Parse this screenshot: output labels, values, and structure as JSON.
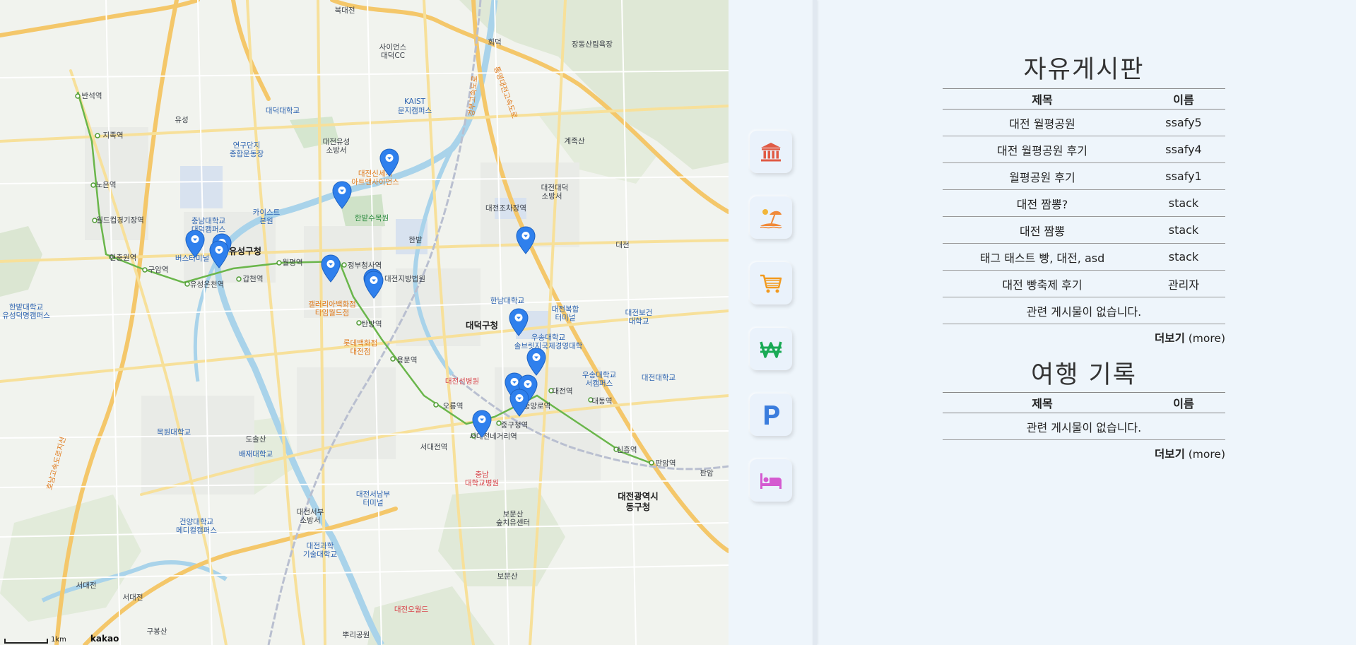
{
  "map": {
    "labels": [
      {
        "text": "북대전",
        "style": "",
        "id": "l1"
      },
      {
        "text": "사이언스",
        "style": "",
        "id": "l2"
      },
      {
        "text": "대덕CC",
        "style": "",
        "id": "l3"
      },
      {
        "text": "회덕",
        "style": "",
        "id": "l4"
      },
      {
        "text": "장동산림욕장",
        "style": "",
        "id": "l5"
      },
      {
        "text": "반석역",
        "style": "",
        "id": "l6"
      },
      {
        "text": "대덕대학교",
        "style": "blue",
        "id": "l7"
      },
      {
        "text": "KAIST",
        "style": "blue",
        "id": "l8"
      },
      {
        "text": "문지캠퍼스",
        "style": "blue",
        "id": "l9"
      },
      {
        "text": "유성",
        "style": "",
        "id": "l10"
      },
      {
        "text": "지족역",
        "style": "",
        "id": "l11"
      },
      {
        "text": "연구단지",
        "style": "blue",
        "id": "l12"
      },
      {
        "text": "종합운동장",
        "style": "blue",
        "id": "l13"
      },
      {
        "text": "대전유성",
        "style": "",
        "id": "l14"
      },
      {
        "text": "소방서",
        "style": "",
        "id": "l15"
      },
      {
        "text": "계족산",
        "style": "",
        "id": "l16"
      },
      {
        "text": "대전신세계",
        "style": "orange",
        "id": "l17"
      },
      {
        "text": "아트앤사이언스",
        "style": "orange",
        "id": "l18"
      },
      {
        "text": "대전대덕",
        "style": "",
        "id": "l19"
      },
      {
        "text": "소방서",
        "style": "",
        "id": "l20"
      },
      {
        "text": "노은역",
        "style": "",
        "id": "l21"
      },
      {
        "text": "카이스트",
        "style": "blue",
        "id": "l22"
      },
      {
        "text": "본원",
        "style": "blue",
        "id": "l23"
      },
      {
        "text": "한밭수목원",
        "style": "green",
        "id": "l24"
      },
      {
        "text": "대전조차장역",
        "style": "",
        "id": "l25"
      },
      {
        "text": "충남대학교",
        "style": "blue",
        "id": "l26"
      },
      {
        "text": "대덕캠퍼스",
        "style": "blue",
        "id": "l27"
      },
      {
        "text": "월드컵경기장역",
        "style": "",
        "id": "l28"
      },
      {
        "text": "한밭",
        "style": "",
        "id": "l29"
      },
      {
        "text": "대전",
        "style": "",
        "id": "l30"
      },
      {
        "text": "유성구청",
        "style": "dark",
        "id": "l31"
      },
      {
        "text": "현충원역",
        "style": "",
        "id": "l32"
      },
      {
        "text": "구암역",
        "style": "",
        "id": "l33"
      },
      {
        "text": "버스터미널",
        "style": "blue",
        "id": "l34"
      },
      {
        "text": "월평역",
        "style": "",
        "id": "l35"
      },
      {
        "text": "정부청사역",
        "style": "",
        "id": "l36"
      },
      {
        "text": "대전지방법원",
        "style": "",
        "id": "l37"
      },
      {
        "text": "유성온천역",
        "style": "",
        "id": "l38"
      },
      {
        "text": "갑천역",
        "style": "",
        "id": "l39"
      },
      {
        "text": "한남대학교",
        "style": "blue",
        "id": "l40"
      },
      {
        "text": "대전복합",
        "style": "blue",
        "id": "l41"
      },
      {
        "text": "터미널",
        "style": "blue",
        "id": "l42"
      },
      {
        "text": "대전보건",
        "style": "blue",
        "id": "l43"
      },
      {
        "text": "대학교",
        "style": "blue",
        "id": "l44"
      },
      {
        "text": "갤러리아백화점",
        "style": "orange",
        "id": "l45"
      },
      {
        "text": "타임월드점",
        "style": "orange",
        "id": "l46"
      },
      {
        "text": "한밭대학교",
        "style": "blue",
        "id": "l47"
      },
      {
        "text": "유성덕명캠퍼스",
        "style": "blue",
        "id": "l48"
      },
      {
        "text": "탄방역",
        "style": "",
        "id": "l49"
      },
      {
        "text": "대덕구청",
        "style": "dark",
        "id": "l50"
      },
      {
        "text": "우송대학교",
        "style": "blue",
        "id": "l51"
      },
      {
        "text": "솔브릿지국제경영대학",
        "style": "blue",
        "id": "l52"
      },
      {
        "text": "롯데백화점",
        "style": "orange",
        "id": "l53"
      },
      {
        "text": "대전점",
        "style": "orange",
        "id": "l54"
      },
      {
        "text": "용문역",
        "style": "",
        "id": "l55"
      },
      {
        "text": "우송대학교",
        "style": "blue",
        "id": "l56"
      },
      {
        "text": "서캠퍼스",
        "style": "blue",
        "id": "l57"
      },
      {
        "text": "대전대학교",
        "style": "blue",
        "id": "l58"
      },
      {
        "text": "대전선병원",
        "style": "red",
        "id": "l59"
      },
      {
        "text": "대전역",
        "style": "",
        "id": "l60"
      },
      {
        "text": "대동역",
        "style": "",
        "id": "l61"
      },
      {
        "text": "오룡역",
        "style": "",
        "id": "l62"
      },
      {
        "text": "중앙로역",
        "style": "",
        "id": "l63"
      },
      {
        "text": "목원대학교",
        "style": "blue",
        "id": "l64"
      },
      {
        "text": "중구청역",
        "style": "",
        "id": "l65"
      },
      {
        "text": "서대전네거리역",
        "style": "",
        "id": "l66"
      },
      {
        "text": "도솔산",
        "style": "",
        "id": "l67"
      },
      {
        "text": "배재대학교",
        "style": "blue",
        "id": "l68"
      },
      {
        "text": "서대전역",
        "style": "",
        "id": "l69"
      },
      {
        "text": "신흥역",
        "style": "",
        "id": "l70"
      },
      {
        "text": "판암역",
        "style": "",
        "id": "l71"
      },
      {
        "text": "판암",
        "style": "",
        "id": "l72"
      },
      {
        "text": "충남",
        "style": "red",
        "id": "l73"
      },
      {
        "text": "대학교병원",
        "style": "red",
        "id": "l74"
      },
      {
        "text": "대전서남부",
        "style": "blue",
        "id": "l75"
      },
      {
        "text": "터미널",
        "style": "blue",
        "id": "l76"
      },
      {
        "text": "대전광역시",
        "style": "dark",
        "id": "l77"
      },
      {
        "text": "동구청",
        "style": "dark",
        "id": "l78"
      },
      {
        "text": "대전서부",
        "style": "",
        "id": "l79"
      },
      {
        "text": "소방서",
        "style": "",
        "id": "l80"
      },
      {
        "text": "보문산",
        "style": "",
        "id": "l81"
      },
      {
        "text": "숲치유센터",
        "style": "",
        "id": "l82"
      },
      {
        "text": "건양대학교",
        "style": "blue",
        "id": "l83"
      },
      {
        "text": "메디컬캠퍼스",
        "style": "blue",
        "id": "l84"
      },
      {
        "text": "대전과학",
        "style": "blue",
        "id": "l85"
      },
      {
        "text": "기술대학교",
        "style": "blue",
        "id": "l86"
      },
      {
        "text": "보문산",
        "style": "",
        "id": "l87"
      },
      {
        "text": "서대전",
        "style": "",
        "id": "l88"
      },
      {
        "text": "서대전",
        "style": "",
        "id": "l89"
      },
      {
        "text": "대전오월드",
        "style": "red",
        "id": "l90"
      },
      {
        "text": "구봉산",
        "style": "",
        "id": "l91"
      },
      {
        "text": "뿌리공원",
        "style": "",
        "id": "l92"
      },
      {
        "text": "호남고속도로지선",
        "style": "orange",
        "id": "l93"
      },
      {
        "text": "경부고속도로",
        "style": "orange",
        "id": "l94"
      },
      {
        "text": "통영대전고속도로",
        "style": "orange",
        "id": "l95"
      }
    ],
    "marker_count": 15,
    "scale_text": "1km",
    "attribution": "kakao"
  },
  "categories": [
    {
      "name": "museum",
      "color": "#e05a44"
    },
    {
      "name": "beach",
      "color": "#f08a3a"
    },
    {
      "name": "shopping-cart",
      "color": "#f29a1e"
    },
    {
      "name": "won",
      "color": "#1aaa55"
    },
    {
      "name": "parking",
      "color": "#3b7ddd"
    },
    {
      "name": "lodging",
      "color": "#d45ad0"
    }
  ],
  "free_board": {
    "title": "자유게시판",
    "col_title": "제목",
    "col_name": "이름",
    "rows": [
      {
        "title": "대전 월평공원",
        "name": "ssafy5"
      },
      {
        "title": "대전 월평공원 후기",
        "name": "ssafy4"
      },
      {
        "title": "월평공원 후기",
        "name": "ssafy1"
      },
      {
        "title": "대전 짬뽕?",
        "name": "stack"
      },
      {
        "title": "대전 짬뽕",
        "name": "stack"
      },
      {
        "title": "태그 태스트 빵, 대전, asd",
        "name": "stack"
      },
      {
        "title": "대전 빵축제 후기",
        "name": "관리자"
      }
    ],
    "empty_text": "관련 게시물이 없습니다.",
    "more_bold": "더보기",
    "more_rest": " (more)"
  },
  "travel_log": {
    "title": "여행 기록",
    "col_title": "제목",
    "col_name": "이름",
    "empty_text": "관련 게시물이 없습니다.",
    "more_bold": "더보기",
    "more_rest": " (more)"
  }
}
